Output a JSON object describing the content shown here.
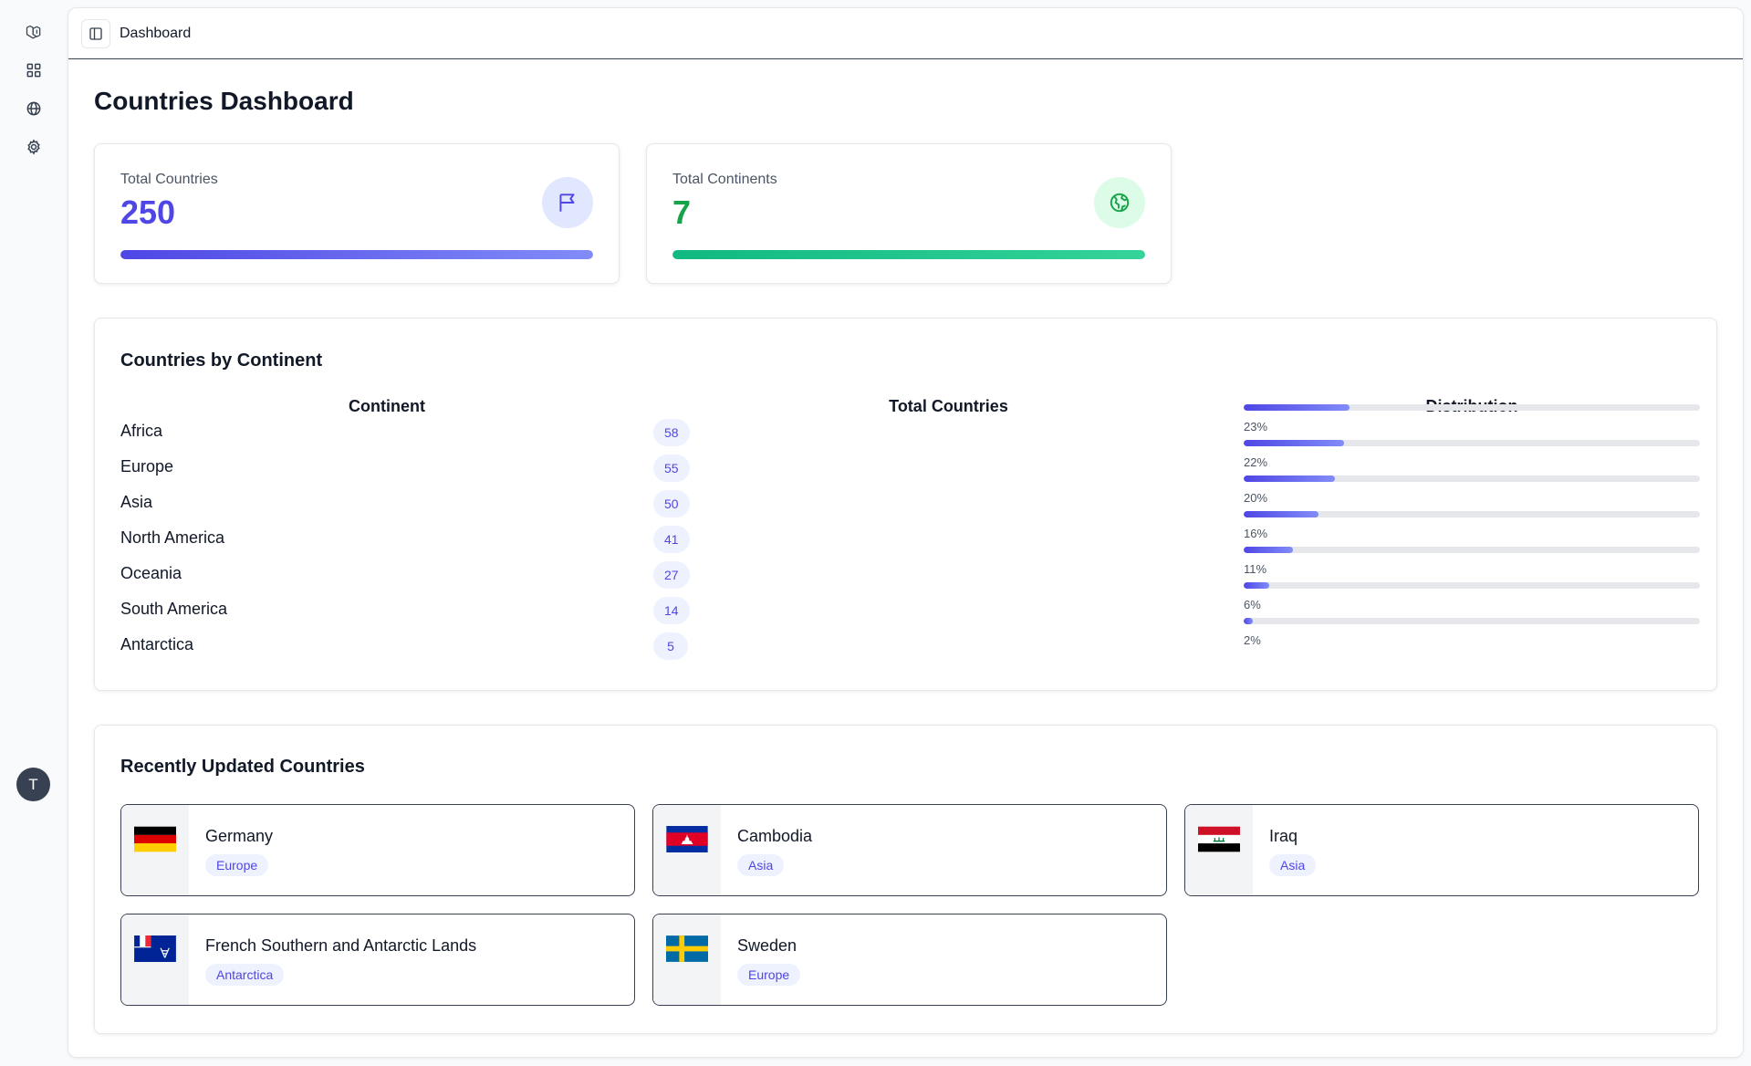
{
  "app": {
    "breadcrumb": "Dashboard",
    "user_initial": "T"
  },
  "page": {
    "title": "Countries Dashboard"
  },
  "stats": {
    "countries": {
      "label": "Total Countries",
      "value": "250",
      "color": "#4f46e5"
    },
    "continents": {
      "label": "Total Continents",
      "value": "7",
      "color": "#16a34a"
    }
  },
  "by_continent": {
    "title": "Countries by Continent",
    "headers": {
      "continent": "Continent",
      "total": "Total Countries",
      "distribution": "Distribution"
    },
    "rows": [
      {
        "name": "Africa",
        "count": "58",
        "pct": "23%",
        "fraction": 0.232
      },
      {
        "name": "Europe",
        "count": "55",
        "pct": "22%",
        "fraction": 0.22
      },
      {
        "name": "Asia",
        "count": "50",
        "pct": "20%",
        "fraction": 0.2
      },
      {
        "name": "North America",
        "count": "41",
        "pct": "16%",
        "fraction": 0.164
      },
      {
        "name": "Oceania",
        "count": "27",
        "pct": "11%",
        "fraction": 0.108
      },
      {
        "name": "South America",
        "count": "14",
        "pct": "6%",
        "fraction": 0.056
      },
      {
        "name": "Antarctica",
        "count": "5",
        "pct": "2%",
        "fraction": 0.02
      }
    ]
  },
  "recent": {
    "title": "Recently Updated Countries",
    "countries": [
      {
        "name": "Germany",
        "continent": "Europe",
        "flag": "germany-flag"
      },
      {
        "name": "Cambodia",
        "continent": "Asia",
        "flag": "cambodia-flag"
      },
      {
        "name": "Iraq",
        "continent": "Asia",
        "flag": "iraq-flag"
      },
      {
        "name": "French Southern and Antarctic Lands",
        "continent": "Antarctica",
        "flag": "french-southern-lands-flag"
      },
      {
        "name": "Sweden",
        "continent": "Europe",
        "flag": "sweden-flag"
      }
    ]
  },
  "colors": {
    "accent": "#4f46e5",
    "success": "#16a34a",
    "badge_bg": "#eef2ff"
  },
  "icons": {
    "rail": [
      "logo-icon",
      "dashboard-grid-icon",
      "globe-icon",
      "settings-gear-icon"
    ],
    "stats": [
      "flag-icon",
      "globe-icon"
    ]
  }
}
